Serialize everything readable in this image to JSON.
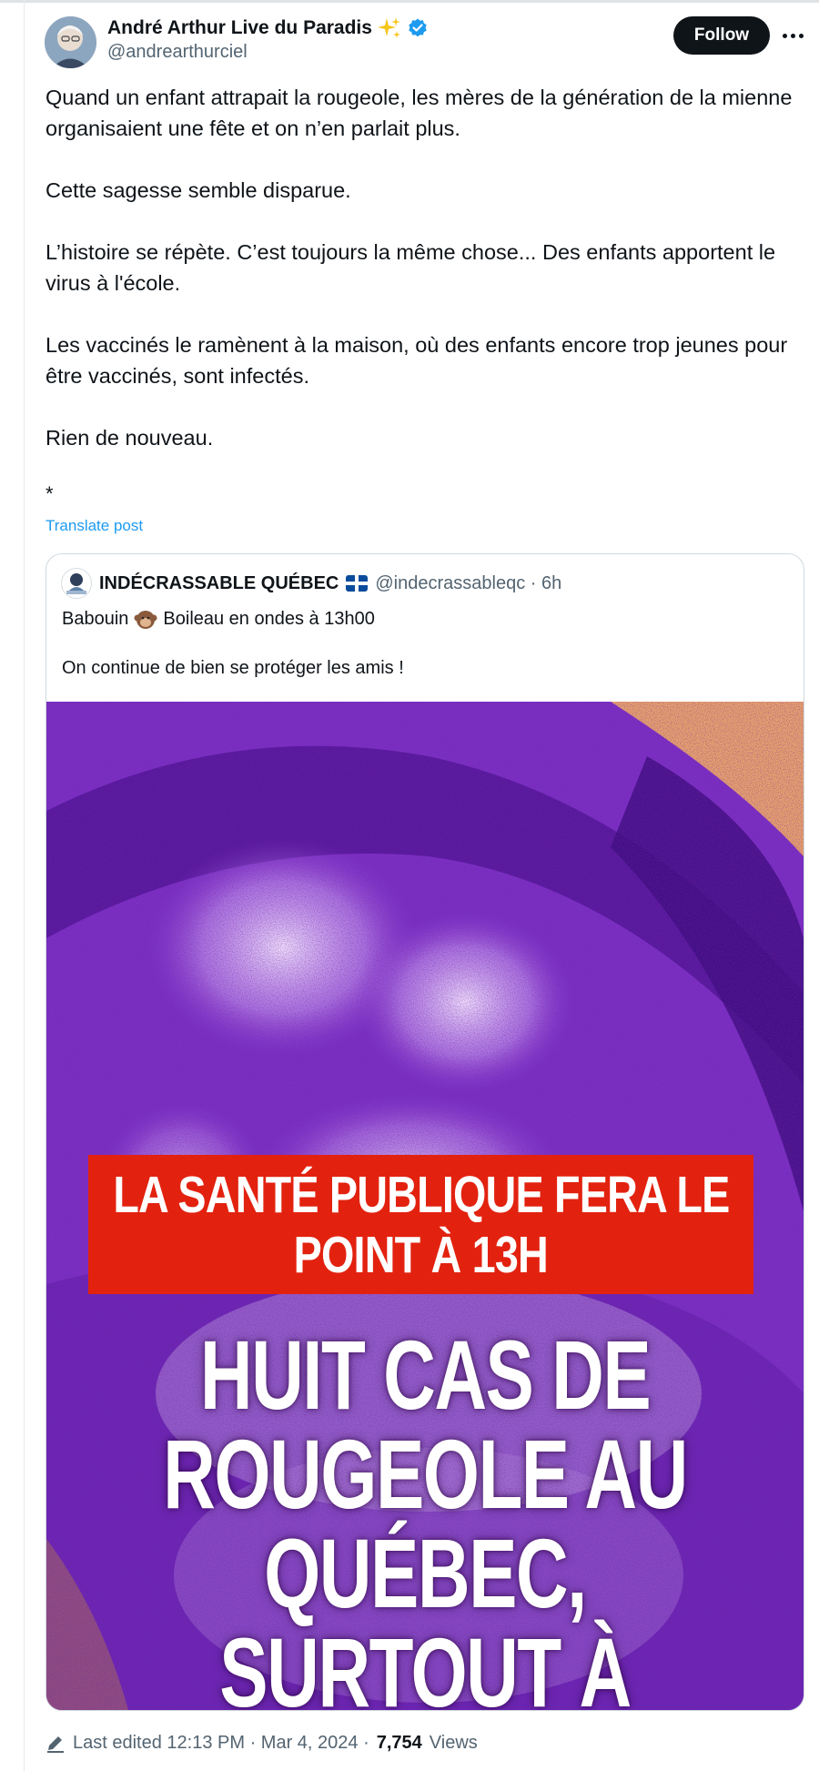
{
  "author": {
    "display_name": "André Arthur Live du Paradis",
    "handle": "@andrearthurciel",
    "badge_emoji": "sparkles",
    "verified": true
  },
  "actions": {
    "follow_label": "Follow",
    "more_icon": "more-horizontal-icon"
  },
  "post": {
    "paragraphs": [
      "Quand un enfant attrapait la rougeole, les mères de la génération de la mienne organisaient une fête et on n’en parlait plus.",
      "Cette sagesse semble disparue.",
      "L’histoire se répète. C’est toujours la même chose... Des enfants apportent le virus à l'école.",
      "Les vaccinés le ramènent à la maison, où des enfants encore trop jeunes pour être vaccinés, sont infectés.",
      "Rien de nouveau.",
      "*"
    ],
    "translate_label": "Translate post"
  },
  "quote": {
    "name": "INDÉCRASSABLE QUÉBEC",
    "handle_time": "@indecrassableqc · 6h",
    "line1_before": "Babouin",
    "line1_after": "Boileau en ondes à 13h00",
    "line2": "On continue de bien se protéger les amis !",
    "media": {
      "banner_line1": "LA SANTÉ PUBLIQUE FERA LE",
      "banner_line2": "POINT À 13H",
      "headline": [
        "HUIT CAS DE",
        "ROUGEOLE AU",
        "QUÉBEC,",
        "SURTOUT À"
      ]
    }
  },
  "footer": {
    "edited": "Last edited 12:13 PM · Mar 4, 2024 ·",
    "views_count": "7,754",
    "views_label": "Views"
  },
  "colors": {
    "accent": "#1d9bf0",
    "text": "#0f1419",
    "secondary": "#536471",
    "banner_red": "#e2220f",
    "media_purple": "#5a1aa0"
  }
}
